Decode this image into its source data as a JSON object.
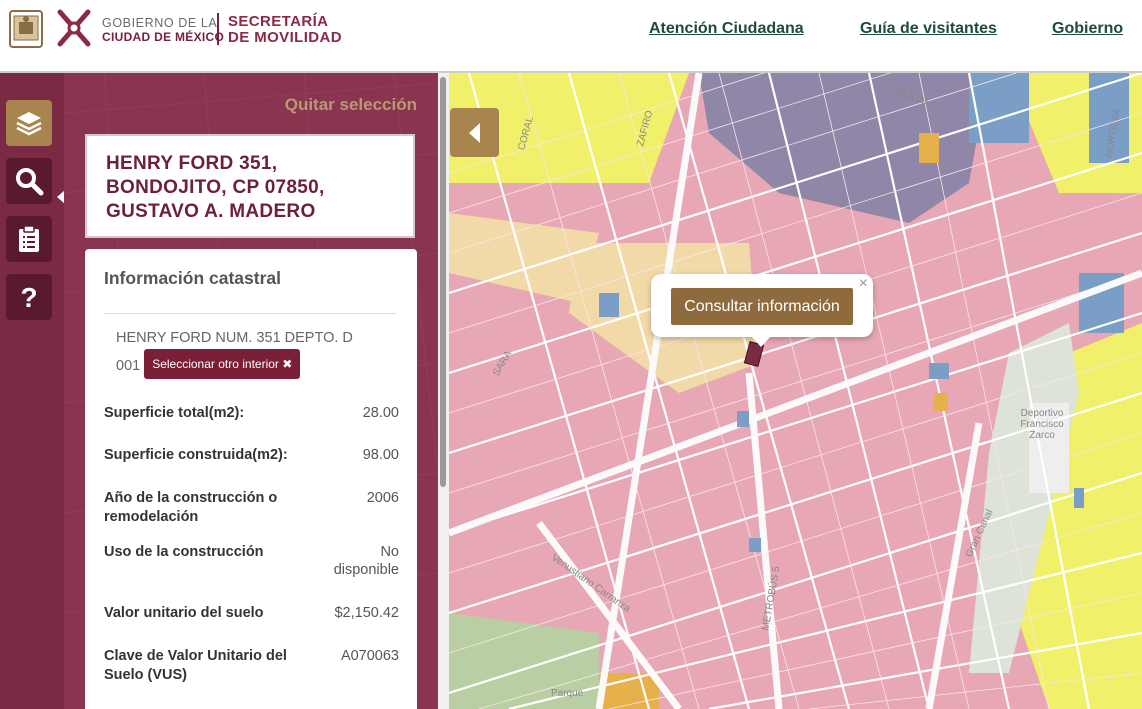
{
  "header": {
    "gov_line1": "GOBIERNO DE LA",
    "gov_line2": "CIUDAD DE MÉXICO",
    "sec_line1": "SECRETARÍA",
    "sec_line2": "DE MOVILIDAD",
    "nav": [
      "Atención Ciudadana",
      "Guía de visitantes",
      "Gobierno"
    ]
  },
  "rail": {
    "buttons": [
      "layers-icon",
      "search-icon",
      "clipboard-icon",
      "help-icon"
    ],
    "accent": "#a8854e"
  },
  "panel": {
    "clear_label": "Quitar selección",
    "address_lines": [
      "HENRY FORD 351,",
      "BONDOJITO, CP 07850,",
      "GUSTAVO A. MADERO"
    ],
    "info_title": "Información catastral",
    "interior_text": "HENRY FORD NUM. 351 DEPTO. D 001",
    "select_other_label": "Seleccionar otro interior ✖",
    "rows": [
      {
        "label": "Superficie total(m2):",
        "value": "28.00"
      },
      {
        "label": "Superficie construida(m2):",
        "value": "98.00"
      },
      {
        "label": "Año de la construcción o remodelación",
        "value": "2006"
      },
      {
        "label": "Uso de la construcción",
        "value": "No disponible"
      },
      {
        "label": "Valor unitario del suelo",
        "value": "$2,150.42"
      },
      {
        "label": "Clave de Valor Unitario del Suelo (VUS)",
        "value": "A070063"
      }
    ]
  },
  "map": {
    "popup_button": "Consultar información",
    "popup_close": "×",
    "labels": {
      "pelicano": "PELICANO",
      "norte84": "NORTE 84",
      "deportivo": "Deportivo Francisco Zarco",
      "venustiano": "Venustiano Carranza",
      "metrobus": "METROBÚS 5",
      "gran_canal": "Gran Canal",
      "parque": "Parque",
      "coral": "CORAL",
      "zafiro": "ZAFIRO",
      "sara": "SARA"
    },
    "colors": {
      "residential": "#e7a7b4",
      "commercial": "#f1f06a",
      "equipment": "#8f86a8",
      "water": "#7a9ec6",
      "green": "#b9cfa3",
      "mixed": "#f2d9a8"
    }
  }
}
